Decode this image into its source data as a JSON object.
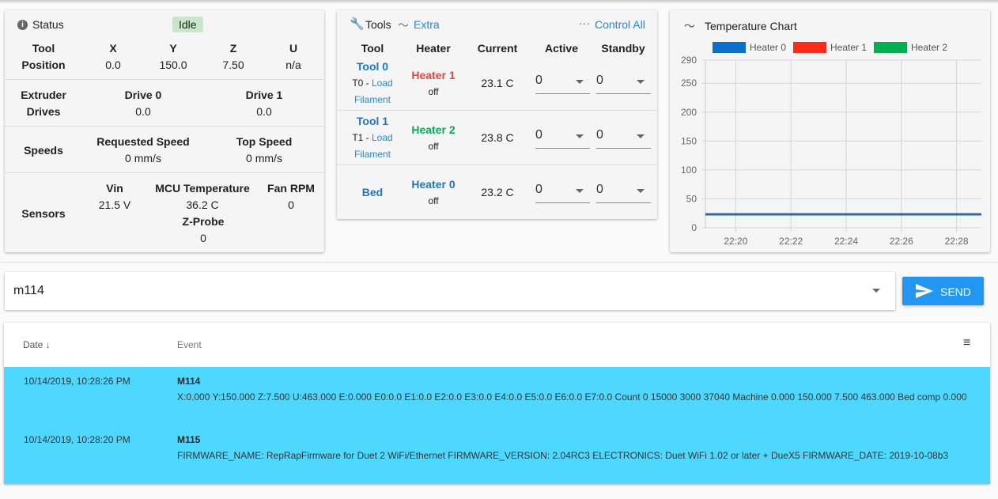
{
  "status": {
    "title": "Status",
    "state": "Idle",
    "tool_position_label": "Tool Position",
    "tool_position_label_1": "Tool",
    "tool_position_label_2": "Position",
    "axes": [
      {
        "name": "X",
        "value": "0.0"
      },
      {
        "name": "Y",
        "value": "150.0"
      },
      {
        "name": "Z",
        "value": "7.50"
      },
      {
        "name": "U",
        "value": "n/a"
      }
    ],
    "extruder_label_1": "Extruder",
    "extruder_label_2": "Drives",
    "drives": [
      {
        "name": "Drive 0",
        "value": "0.0"
      },
      {
        "name": "Drive 1",
        "value": "0.0"
      }
    ],
    "speeds_label": "Speeds",
    "speeds": [
      {
        "name": "Requested Speed",
        "value": "0 mm/s"
      },
      {
        "name": "Top Speed",
        "value": "0 mm/s"
      }
    ],
    "sensors_label": "Sensors",
    "sensors": [
      {
        "name": "Vin",
        "value": "21.5 V"
      },
      {
        "name": "MCU Temperature",
        "value": "36.2 C"
      },
      {
        "name": "Fan RPM",
        "value": "0"
      },
      {
        "name": "Z-Probe",
        "value": "0"
      }
    ]
  },
  "tools": {
    "title": "Tools",
    "extra": "Extra",
    "control_all": "Control All",
    "headers": [
      "Tool",
      "Heater",
      "Current",
      "Active",
      "Standby"
    ],
    "rows": [
      {
        "tool": "Tool 0",
        "sub_prefix": "T0 - ",
        "sub_link": "Load",
        "sub_link2": "Filament",
        "heater": "Heater 1",
        "heater_color": "#f44336",
        "state": "off",
        "current": "23.1 C",
        "active": "0",
        "standby": "0"
      },
      {
        "tool": "Tool 1",
        "sub_prefix": "T1 - ",
        "sub_link": "Load",
        "sub_link2": "Filament",
        "heater": "Heater 2",
        "heater_color": "#00c853",
        "state": "off",
        "current": "23.8 C",
        "active": "0",
        "standby": "0"
      },
      {
        "tool": "Bed",
        "heater": "Heater 0",
        "heater_color": "#1976d2",
        "state": "off",
        "current": "23.2 C",
        "active": "0",
        "standby": "0"
      }
    ]
  },
  "chart_data": {
    "type": "line",
    "title": "Temperature Chart",
    "legend": [
      {
        "name": "Heater 0",
        "color": "#0b6fcc"
      },
      {
        "name": "Heater 1",
        "color": "#ff2b1a"
      },
      {
        "name": "Heater 2",
        "color": "#00b050"
      }
    ],
    "legend_position": "top",
    "grid": true,
    "ylim": [
      0,
      290
    ],
    "yticks": [
      "0",
      "50",
      "100",
      "150",
      "200",
      "250",
      "290"
    ],
    "xticks": [
      "22:20",
      "22:22",
      "22:24",
      "22:26",
      "22:28"
    ],
    "xlim_minutes": [
      "22:18.9",
      "22:28.9"
    ],
    "series": [
      {
        "name": "Heater 0",
        "x": [
          "22:18.9",
          "22:28.9"
        ],
        "y": [
          23.2,
          23.2
        ]
      }
    ]
  },
  "console": {
    "command": "m114",
    "send": "SEND"
  },
  "log": {
    "headers": {
      "date": "Date",
      "event": "Event"
    },
    "rows": [
      {
        "date": "10/14/2019, 10:28:26 PM",
        "title": "M114",
        "body": "X:0.000 Y:150.000 Z:7.500 U:463.000 E:0.000 E0:0.0 E1:0.0 E2:0.0 E3:0.0 E4:0.0 E5:0.0 E6:0.0 E7:0.0 Count 0 15000 3000 37040 Machine 0.000 150.000 7.500 463.000 Bed comp 0.000"
      },
      {
        "date": "10/14/2019, 10:28:20 PM",
        "title": "M115",
        "body": "FIRMWARE_NAME: RepRapFirmware for Duet 2 WiFi/Ethernet FIRMWARE_VERSION: 2.04RC3 ELECTRONICS: Duet WiFi 1.02 or later + DueX5 FIRMWARE_DATE: 2019-10-08b3"
      }
    ]
  }
}
